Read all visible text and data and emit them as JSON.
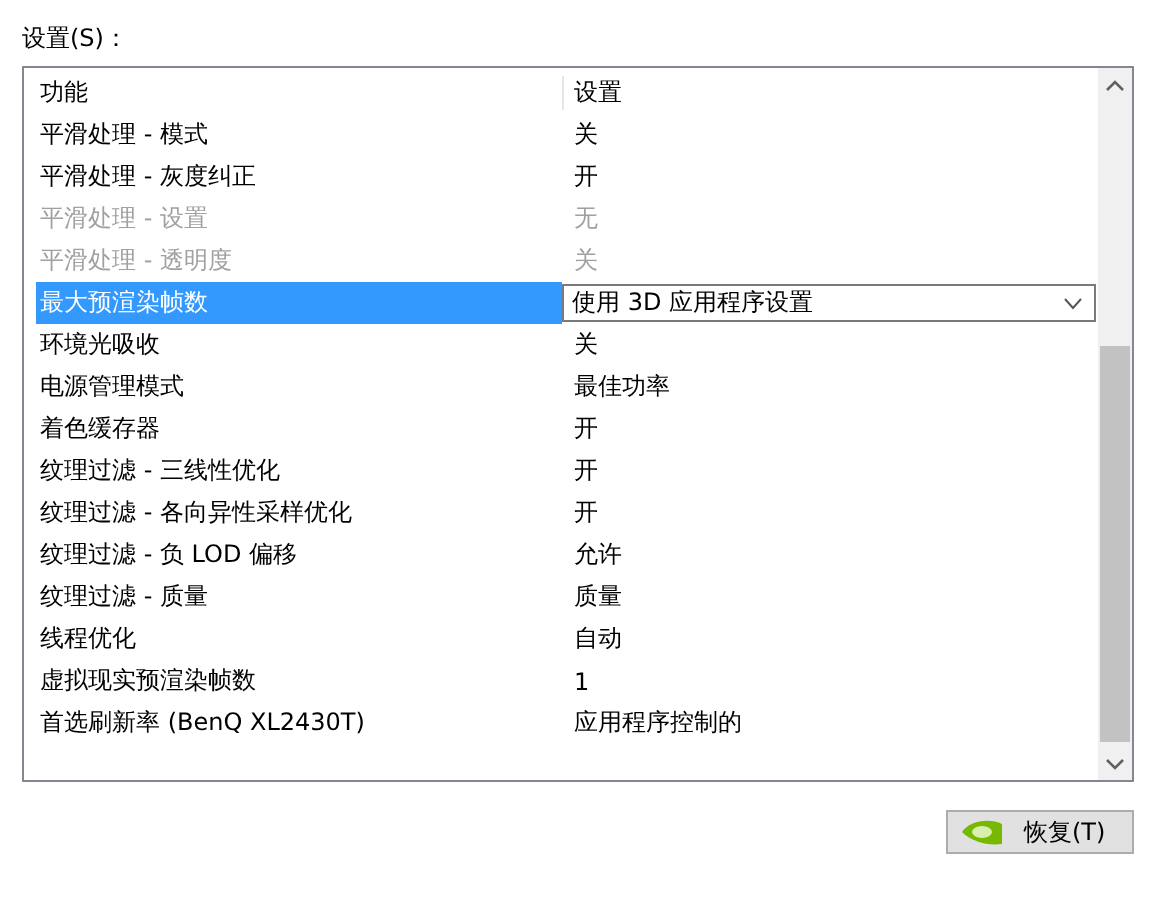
{
  "label": "设置(S)：",
  "table": {
    "columns": [
      "功能",
      "设置"
    ],
    "rows": [
      {
        "feature": "平滑处理 - 模式",
        "setting": "关",
        "disabled": false,
        "selected": false
      },
      {
        "feature": "平滑处理 - 灰度纠正",
        "setting": "开",
        "disabled": false,
        "selected": false
      },
      {
        "feature": "平滑处理 - 设置",
        "setting": "无",
        "disabled": true,
        "selected": false
      },
      {
        "feature": "平滑处理 - 透明度",
        "setting": "关",
        "disabled": true,
        "selected": false
      },
      {
        "feature": "最大预渲染帧数",
        "setting": "使用 3D 应用程序设置",
        "disabled": false,
        "selected": true
      },
      {
        "feature": "环境光吸收",
        "setting": "关",
        "disabled": false,
        "selected": false
      },
      {
        "feature": "电源管理模式",
        "setting": "最佳功率",
        "disabled": false,
        "selected": false
      },
      {
        "feature": "着色缓存器",
        "setting": "开",
        "disabled": false,
        "selected": false
      },
      {
        "feature": "纹理过滤 - 三线性优化",
        "setting": "开",
        "disabled": false,
        "selected": false
      },
      {
        "feature": "纹理过滤 - 各向异性采样优化",
        "setting": "开",
        "disabled": false,
        "selected": false
      },
      {
        "feature": "纹理过滤 - 负 LOD 偏移",
        "setting": "允许",
        "disabled": false,
        "selected": false
      },
      {
        "feature": "纹理过滤 - 质量",
        "setting": "质量",
        "disabled": false,
        "selected": false
      },
      {
        "feature": "线程优化",
        "setting": "自动",
        "disabled": false,
        "selected": false
      },
      {
        "feature": "虚拟现实预渲染帧数",
        "setting": "1",
        "disabled": false,
        "selected": false
      },
      {
        "feature": "首选刷新率 (BenQ XL2430T)",
        "setting": "应用程序控制的",
        "disabled": false,
        "selected": false
      }
    ]
  },
  "buttons": [
    {
      "label": "恢复(T)"
    }
  ]
}
